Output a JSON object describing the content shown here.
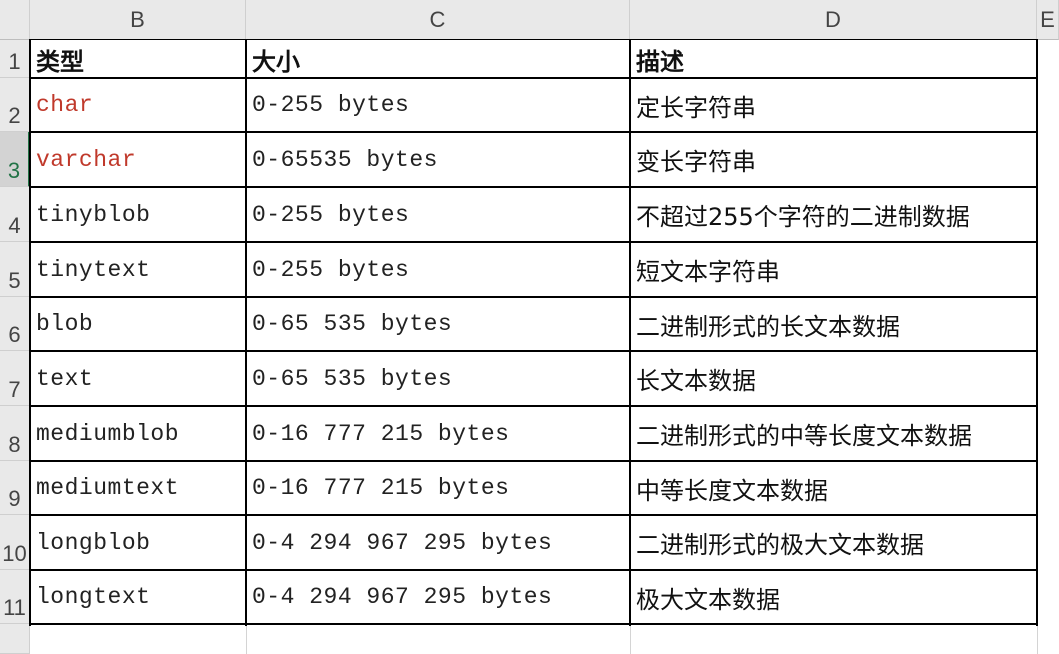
{
  "columns": [
    "B",
    "C",
    "D",
    "E"
  ],
  "rows": [
    {
      "num": "1",
      "cells": [
        "类型",
        "大小",
        "描述"
      ]
    },
    {
      "num": "2",
      "cells": [
        "char",
        "0-255 bytes",
        "定长字符串"
      ]
    },
    {
      "num": "3",
      "cells": [
        "varchar",
        "0-65535 bytes",
        "变长字符串"
      ]
    },
    {
      "num": "4",
      "cells": [
        "tinyblob",
        "0-255 bytes",
        "不超过255个字符的二进制数据"
      ]
    },
    {
      "num": "5",
      "cells": [
        "tinytext",
        "0-255 bytes",
        "短文本字符串"
      ]
    },
    {
      "num": "6",
      "cells": [
        "blob",
        "0-65 535 bytes",
        "二进制形式的长文本数据"
      ]
    },
    {
      "num": "7",
      "cells": [
        "text",
        "0-65 535 bytes",
        "长文本数据"
      ]
    },
    {
      "num": "8",
      "cells": [
        "mediumblob",
        "0-16 777 215 bytes",
        "二进制形式的中等长度文本数据"
      ]
    },
    {
      "num": "9",
      "cells": [
        "mediumtext",
        "0-16 777 215 bytes",
        "中等长度文本数据"
      ]
    },
    {
      "num": "10",
      "cells": [
        "longblob",
        "0-4 294 967 295 bytes",
        "二进制形式的极大文本数据"
      ]
    },
    {
      "num": "11",
      "cells": [
        "longtext",
        "0-4 294 967 295 bytes",
        "极大文本数据"
      ]
    }
  ],
  "styles": {
    "red_text_color": "#c0392b",
    "active_row_indicator_color": "#217346"
  }
}
